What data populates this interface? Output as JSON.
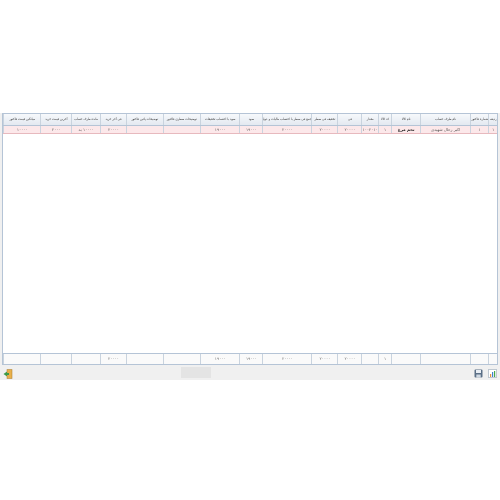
{
  "grid": {
    "columns": [
      {
        "label": "ردیف"
      },
      {
        "label": "شماره فاکتور"
      },
      {
        "label": "نام طرف حساب"
      },
      {
        "label": "نام کالا"
      },
      {
        "label": "کد کالا"
      },
      {
        "label": "مقدار"
      },
      {
        "label": "فی"
      },
      {
        "label": "تخفیف فی سطر"
      },
      {
        "label": "جمع فی سطر با احتساب مالیات و عوارض"
      },
      {
        "label": "سود"
      },
      {
        "label": "سود با احتساب تخفیفات"
      },
      {
        "label": "توضیحات سطری فاکتور"
      },
      {
        "label": "توضیحات پائین فاکتور"
      },
      {
        "label": "فی آخر خرید"
      },
      {
        "label": "مانده طرف حساب"
      },
      {
        "label": "آخرین قیمت خرید"
      },
      {
        "label": "میانگین قیمت فاکتور"
      }
    ],
    "rows": [
      [
        "۱",
        "۱",
        "اکبر رحال شهیدی",
        "تخم مرغ",
        "۱",
        "۱۰۰۲۰۱۰",
        "۲۰۰۰۰",
        "۲۰۰۰۰",
        "۲۰۰۰۰",
        "۱۹۰۰۰",
        "۱۹۰۰۰",
        "",
        "",
        "۲۰۰۰۰",
        "۱۰۰۰۰ بد",
        "۲۰۰۰",
        "۱۰۰۰۰"
      ]
    ],
    "footer": [
      "",
      "",
      "",
      "",
      "۱",
      "",
      "۲۰۰۰۰",
      "۲۰۰۰۰",
      "۲۰۰۰۰",
      "۱۹۰۰۰",
      "۱۹۰۰۰",
      "",
      "",
      "۲۰۰۰۰",
      "",
      "",
      ""
    ]
  },
  "toolbar": {
    "icons": [
      "chart-icon",
      "save-icon",
      "exit-icon"
    ]
  }
}
